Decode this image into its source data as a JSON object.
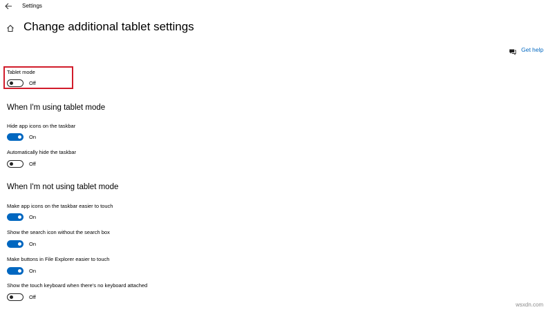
{
  "window": {
    "title": "Settings"
  },
  "header": {
    "title": "Change additional tablet settings"
  },
  "help": {
    "label": "Get help"
  },
  "tablet_mode": {
    "label": "Tablet mode",
    "state": "Off"
  },
  "section_using": {
    "title": "When I'm using tablet mode",
    "settings": [
      {
        "label": "Hide app icons on the taskbar",
        "state": "On"
      },
      {
        "label": "Automatically hide the taskbar",
        "state": "Off"
      }
    ]
  },
  "section_not_using": {
    "title": "When I'm not using tablet mode",
    "settings": [
      {
        "label": "Make app icons on the taskbar easier to touch",
        "state": "On"
      },
      {
        "label": "Show the search icon without the search box",
        "state": "On"
      },
      {
        "label": "Make buttons in File Explorer easier to touch",
        "state": "On"
      },
      {
        "label": "Show the touch keyboard when there's no keyboard attached",
        "state": "Off"
      }
    ]
  },
  "watermark": "wsxdn.com",
  "colors": {
    "accent": "#0067c0",
    "highlight": "#d11b2a"
  }
}
